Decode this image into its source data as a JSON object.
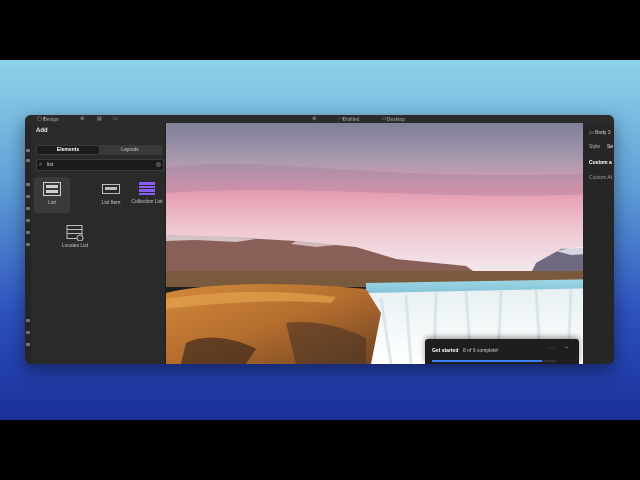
{
  "topbar": {
    "page_label": "Design",
    "doc_label": "Untitled",
    "device_label": "Desktop"
  },
  "add_panel": {
    "title": "Add",
    "tabs": [
      {
        "label": "Elements",
        "active": true
      },
      {
        "label": "Layouts",
        "active": false
      }
    ],
    "search": {
      "value": "list"
    },
    "elements": [
      {
        "label": "List",
        "icon": "list-icon",
        "selected": true
      },
      {
        "label": "List Item",
        "icon": "list-item-icon",
        "selected": false
      },
      {
        "label": "Collection List",
        "icon": "collection-list-icon",
        "selected": false
      },
      {
        "label": "Locales List",
        "icon": "locales-list-icon",
        "selected": false
      }
    ]
  },
  "right_panel": {
    "breadcrumb": "Body 2",
    "tabs": [
      "Style",
      "Se"
    ],
    "section_title": "Custom a",
    "field_label": "Custom At"
  },
  "toast": {
    "title": "Get started",
    "progress_text": "8 of 9 complete!",
    "progress": 0.889
  },
  "colors": {
    "accent": "#3b82f6",
    "panel_bg": "#2a2a2a"
  }
}
